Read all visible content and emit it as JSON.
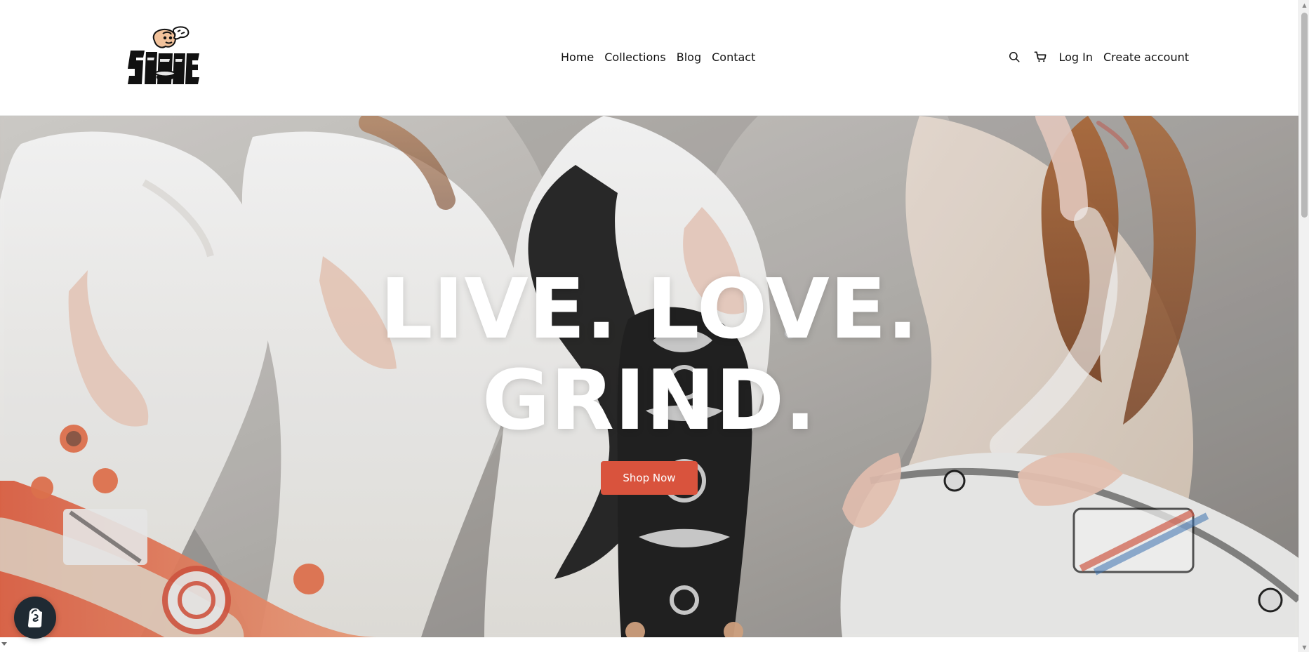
{
  "header": {
    "logo_alt": "Skate logo",
    "nav": [
      {
        "label": "Home"
      },
      {
        "label": "Collections"
      },
      {
        "label": "Blog"
      },
      {
        "label": "Contact"
      }
    ],
    "actions": {
      "search_icon": "search-icon",
      "cart_icon": "cart-icon",
      "login_label": "Log In",
      "create_account_label": "Create account"
    }
  },
  "hero": {
    "title_line1": "LIVE. LOVE.",
    "title_line2": "GRIND.",
    "cta_label": "Shop Now",
    "accent": "#d9533d"
  },
  "badges": {
    "shopify_icon": "shopify-icon"
  }
}
